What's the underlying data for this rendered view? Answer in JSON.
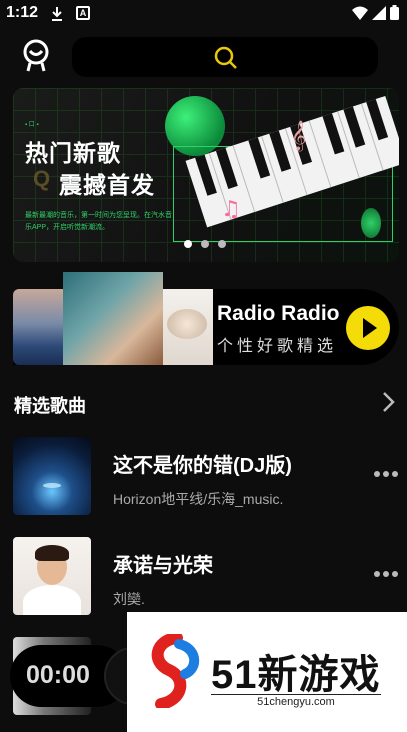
{
  "status_bar": {
    "time": "1:12"
  },
  "banner": {
    "tag": "▪ 口 ▪",
    "title_line1": "热门新歌",
    "q_mark": "Q",
    "title_line2": "震撼首发",
    "subtitle": "最新最潮的音乐，第一时间为您呈现。在汽水音乐APP，开启听觉新潮流。",
    "active_slide": 1,
    "slide_count": 3
  },
  "radio": {
    "title": "Radio Radio",
    "tagline": "个性好歌精选"
  },
  "section": {
    "title": "精选歌曲"
  },
  "songs": [
    {
      "title": "这不是你的错(DJ版)",
      "artist": "Horizon地平线/乐海_music."
    },
    {
      "title": "承诺与光荣",
      "artist": "刘奱."
    }
  ],
  "player": {
    "time": "00:00"
  },
  "watermark": {
    "brand": "51新游戏",
    "url": "51chengyu.com"
  },
  "colors": {
    "accent": "#f3dc08",
    "banner_green": "#2fd06a",
    "background": "#0d0d0d"
  },
  "icons": {
    "download": "download-icon",
    "autofill": "a-box-icon",
    "wifi": "wifi-icon",
    "signal": "signal-icon",
    "battery": "battery-icon",
    "avatar": "user-avatar-icon",
    "search": "search-icon",
    "play": "play-icon",
    "more": "more-dots-icon",
    "chevron": "chevron-right-icon"
  }
}
